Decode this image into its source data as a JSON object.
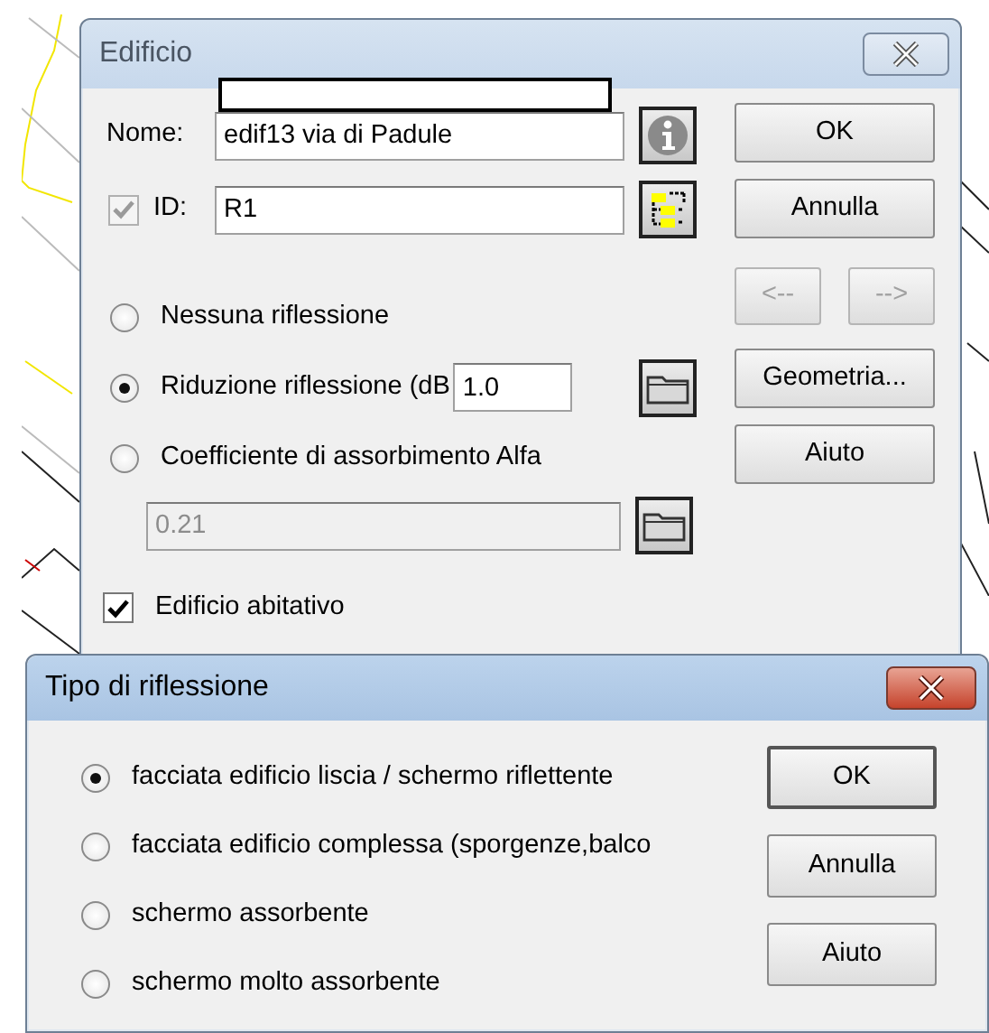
{
  "edificio": {
    "title": "Edificio",
    "name": {
      "label": "Nome:",
      "value": "edif13 via di Padule"
    },
    "id": {
      "label": "ID:",
      "value": "R1",
      "checked": true,
      "disabled": true
    },
    "reflection_options": [
      {
        "label": "Nessuna riflessione",
        "selected": false,
        "kind": "plain"
      },
      {
        "label": "Riduzione riflessione (dB",
        "selected": true,
        "kind": "field",
        "value": "1.0"
      },
      {
        "label": "Coefficiente di assorbimento Alfa",
        "selected": false,
        "kind": "plain"
      }
    ],
    "alpha": {
      "value": "0.21",
      "disabled": true
    },
    "residential": {
      "label": "Edificio abitativo",
      "checked": true
    },
    "buttons": [
      {
        "label": "OK",
        "kind": "wide",
        "disabled": false
      },
      {
        "label": "Annulla",
        "kind": "wide",
        "disabled": false
      },
      {
        "label": "<--",
        "kind": "half",
        "disabled": true
      },
      {
        "label": "-->",
        "kind": "half",
        "disabled": true
      },
      {
        "label": "Geometria...",
        "kind": "wide",
        "disabled": false
      },
      {
        "label": "Aiuto",
        "kind": "wide",
        "disabled": false
      }
    ]
  },
  "tipo_riflessione": {
    "title": "Tipo di riflessione",
    "options": [
      {
        "label": "facciata edificio liscia / schermo riflettente",
        "selected": true
      },
      {
        "label": "facciata edificio complessa (sporgenze,balco",
        "selected": false
      },
      {
        "label": "schermo assorbente",
        "selected": false
      },
      {
        "label": "schermo molto assorbente",
        "selected": false
      }
    ],
    "buttons": [
      {
        "label": "OK",
        "default": true
      },
      {
        "label": "Annulla",
        "default": false
      },
      {
        "label": "Aiuto",
        "default": false
      }
    ]
  }
}
